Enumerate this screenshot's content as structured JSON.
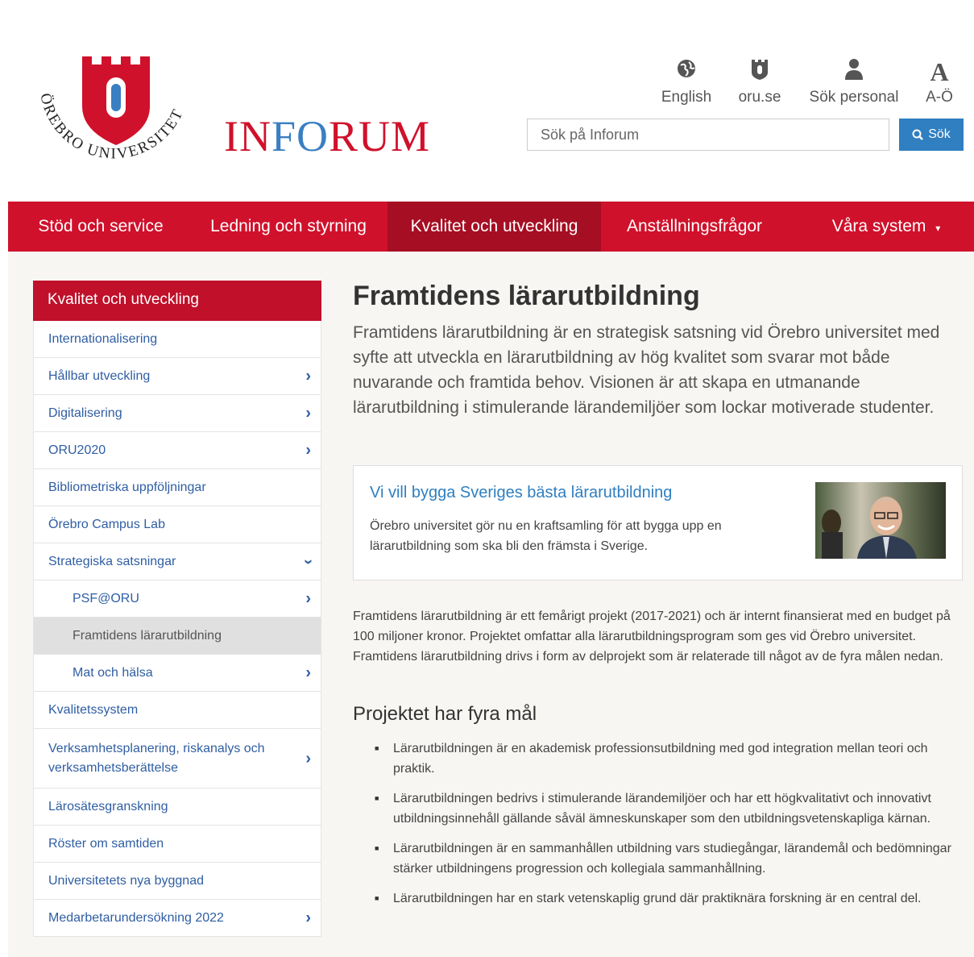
{
  "logo": {
    "text": "ÖREBRO UNIVERSITET",
    "letter": "Ö"
  },
  "brand": {
    "part1": "IN",
    "part2": "FO",
    "part3": "RUM"
  },
  "quicklinks": [
    {
      "icon": "globe-icon",
      "label": "English"
    },
    {
      "icon": "university-logo-icon",
      "label": "oru.se"
    },
    {
      "icon": "person-icon",
      "label": "Sök personal"
    },
    {
      "icon": "az-icon",
      "label": "A-Ö"
    }
  ],
  "search": {
    "placeholder": "Sök på Inforum",
    "button": "Sök"
  },
  "nav": [
    {
      "label": "Stöd och service",
      "active": false
    },
    {
      "label": "Ledning och styrning",
      "active": false
    },
    {
      "label": "Kvalitet och utveckling",
      "active": true
    },
    {
      "label": "Anställningsfrågor",
      "active": false
    },
    {
      "label": "Våra system",
      "active": false
    }
  ],
  "sidebar": {
    "title": "Kvalitet och utveckling",
    "items": [
      {
        "label": "Internationalisering"
      },
      {
        "label": "Hållbar utveckling"
      },
      {
        "label": "Digitalisering"
      },
      {
        "label": "ORU2020"
      },
      {
        "label": "Bibliometriska uppföljningar"
      },
      {
        "label": "Örebro Campus Lab"
      },
      {
        "label": "Strategiska satsningar"
      },
      {
        "label": "PSF@ORU"
      },
      {
        "label": "Framtidens lärarutbildning"
      },
      {
        "label": "Mat och hälsa"
      },
      {
        "label": "Kvalitetssystem"
      },
      {
        "label": "Verksamhetsplanering, riskanalys och verksamhetsberättelse"
      },
      {
        "label": "Lärosätesgranskning"
      },
      {
        "label": "Röster om samtiden"
      },
      {
        "label": "Universitetets nya byggnad"
      },
      {
        "label": "Medarbetarundersökning 2022"
      }
    ]
  },
  "main": {
    "title": "Framtidens lärarutbildning",
    "lead": "Framtidens lärarutbildning är en strategisk satsning vid Örebro universitet med syfte att utveckla en lärarutbildning av hög kvalitet som svarar mot både nuvarande och framtida behov. Visionen är att skapa en utmanande lärarutbildning i stimulerande lärandemiljöer som lockar motiverade studenter.",
    "card": {
      "title": "Vi vill bygga Sveriges bästa lärarutbildning",
      "text": "Örebro universitet gör nu en kraftsamling för att bygga upp en lärarutbildning som ska bli den främsta i Sverige."
    },
    "body": "Framtidens lärarutbildning är ett femårigt projekt (2017-2021) och är internt finansierat med en budget på 100 miljoner kronor. Projektet omfattar alla lärarutbildningsprogram som ges vid Örebro universitet. Framtidens lärarutbildning drivs i form av delprojekt som är relaterade till något av de fyra målen nedan.",
    "goals_title": "Projektet har fyra mål",
    "goals": [
      "Lärarutbildningen är en akademisk professionsutbildning med god integration mellan teori och praktik.",
      "Lärarutbildningen bedrivs i stimulerande lärandemiljöer och har ett högkvalitativt och innovativt utbildningsinnehåll gällande såväl ämneskunskaper som den utbildningsvetenskapliga kärnan.",
      "Lärarutbildningen är en sammanhållen utbildning vars studiegångar, lärandemål och bedömningar stärker utbildningens progression och kollegiala sammanhållning.",
      "Lärarutbildningen har en stark vetenskaplig grund där praktiknära forskning är en central del."
    ]
  },
  "colors": {
    "brand_red": "#d0112b",
    "nav_active": "#a60e23",
    "link_blue": "#2f5ea3",
    "button_blue": "#2f7fc1"
  }
}
